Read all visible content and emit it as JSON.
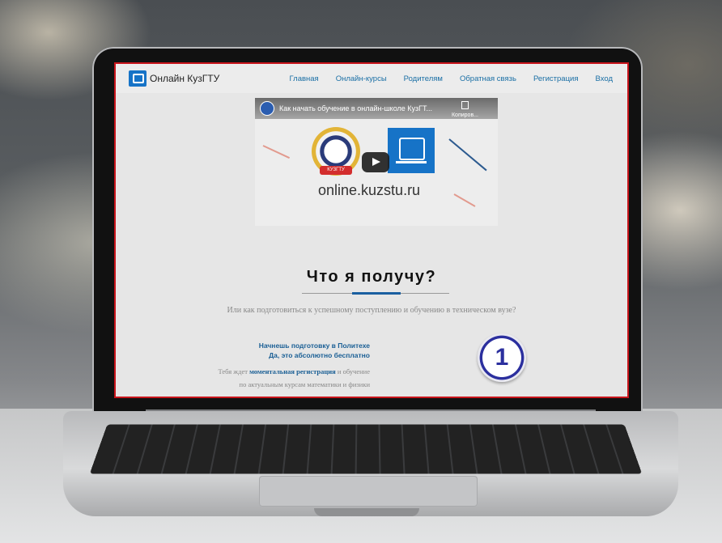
{
  "site": {
    "brand_name": "Онлайн КузГТУ",
    "menu": [
      "Главная",
      "Онлайн-курсы",
      "Родителям",
      "Обратная связь",
      "Регистрация",
      "Вход"
    ]
  },
  "video": {
    "title": "Как начать обучение в онлайн-школе КузГТ...",
    "copy_label": "Копиров...",
    "emblem_ribbon": "КУЗГТУ",
    "url_text": "online.kuzstu.ru"
  },
  "section": {
    "title": "Что я получу?",
    "subtitle": "Или как подготовиться к успешному поступлению и обучению в техническом вузе?"
  },
  "feature": {
    "head_line1": "Начнешь подготовку в Политехе",
    "head_line2": "Да, это абсолютно бесплатно",
    "text_prefix": "Тебя ждет ",
    "text_link": "моментальная регистрация",
    "text_suffix": " и обучение",
    "text_line2": "по актуальным курсам математики и физики",
    "number": "1"
  },
  "colors": {
    "accent": "#1673c7",
    "link": "#1a6fa5",
    "frame": "#c8141b"
  }
}
